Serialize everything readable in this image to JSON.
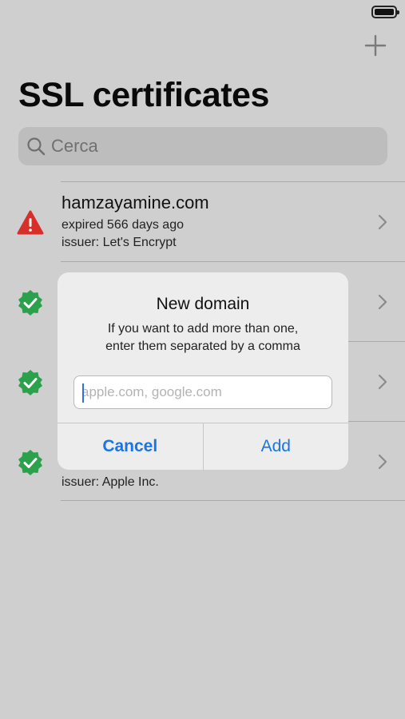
{
  "colors": {
    "accent": "#1b74e4",
    "error": "#d7302a",
    "valid": "#2aa14a"
  },
  "nav": {
    "add_icon": "plus-icon",
    "title": "SSL certificates"
  },
  "search": {
    "icon": "magnifier-icon",
    "placeholder": "Cerca"
  },
  "certificates": [
    {
      "domain": "hamzayamine.com",
      "expiry": "expired 566 days ago",
      "issuer": "issuer: Let's Encrypt",
      "status": "expired"
    },
    {
      "domain": "",
      "expiry": "",
      "issuer": "",
      "status": "valid"
    },
    {
      "domain": "",
      "expiry": "",
      "issuer": "",
      "status": "valid"
    },
    {
      "domain": "",
      "expiry": "",
      "issuer": "issuer: Apple Inc.",
      "status": "valid"
    }
  ],
  "dialog": {
    "title": "New domain",
    "message_line1": "If you want to add more than one,",
    "message_line2": "enter them separated by a comma",
    "input_placeholder": "apple.com, google.com",
    "cancel_label": "Cancel",
    "add_label": "Add"
  }
}
